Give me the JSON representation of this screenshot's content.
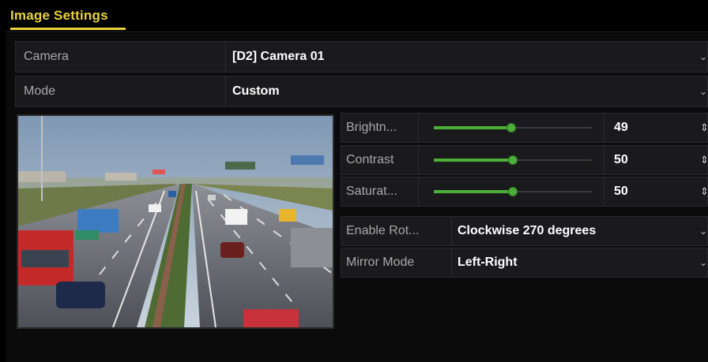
{
  "header": {
    "title": "Image Settings"
  },
  "camera": {
    "label": "Camera",
    "value": "[D2] Camera 01"
  },
  "mode": {
    "label": "Mode",
    "value": "Custom"
  },
  "sliders": [
    {
      "label": "Brightn...",
      "value": "49",
      "level": 0.49
    },
    {
      "label": "Contrast",
      "value": "50",
      "level": 0.5
    },
    {
      "label": "Saturat...",
      "value": "50",
      "level": 0.5
    }
  ],
  "rotation": {
    "label": "Enable Rot...",
    "value": "Clockwise 270 degrees"
  },
  "mirror": {
    "label": "Mirror Mode",
    "value": "Left-Right"
  },
  "colors": {
    "accent": "#e8d23a",
    "slider": "#4caf3a"
  }
}
